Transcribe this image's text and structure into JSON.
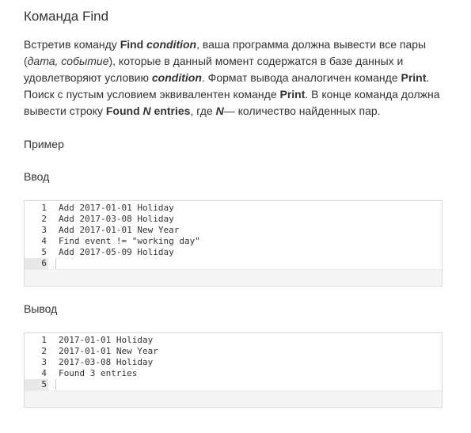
{
  "title": "Команда Find",
  "paragraph": {
    "p1": "Встретив команду ",
    "find1": "Find",
    "cond1": "condition",
    "p2": ", ваша программа должна вывести все пары (",
    "date": "дата",
    "comma": ", ",
    "event": "событие",
    "p3": "), которые в данный момент содержатся в базе данных и удовлетворяют условию ",
    "cond2": "condition",
    "p4": ". Формат вывода аналогичен команде ",
    "print1": "Print",
    "p5": ". Поиск с пустым условием эквивалентен команде ",
    "print2": "Print",
    "p6": ". В конце команда должна вывести строку ",
    "found": "Found",
    "n1": "N",
    "entries": " entries",
    "p7": ", где ",
    "n2": "N",
    "p8": "— количество найденных пар."
  },
  "example_label": "Пример",
  "input_label": "Ввод",
  "output_label": "Вывод",
  "input_block": {
    "lines": [
      {
        "num": "1",
        "text": "Add 2017-01-01 Holiday"
      },
      {
        "num": "2",
        "text": "Add 2017-03-08 Holiday"
      },
      {
        "num": "3",
        "text": "Add 2017-01-01 New Year"
      },
      {
        "num": "4",
        "text": "Find event != \"working day\""
      },
      {
        "num": "5",
        "text": "Add 2017-05-09 Holiday"
      },
      {
        "num": "6",
        "text": ""
      }
    ]
  },
  "output_block": {
    "lines": [
      {
        "num": "1",
        "text": "2017-01-01 Holiday"
      },
      {
        "num": "2",
        "text": "2017-01-01 New Year"
      },
      {
        "num": "3",
        "text": "2017-03-08 Holiday"
      },
      {
        "num": "4",
        "text": "Found 3 entries"
      },
      {
        "num": "5",
        "text": ""
      }
    ]
  }
}
